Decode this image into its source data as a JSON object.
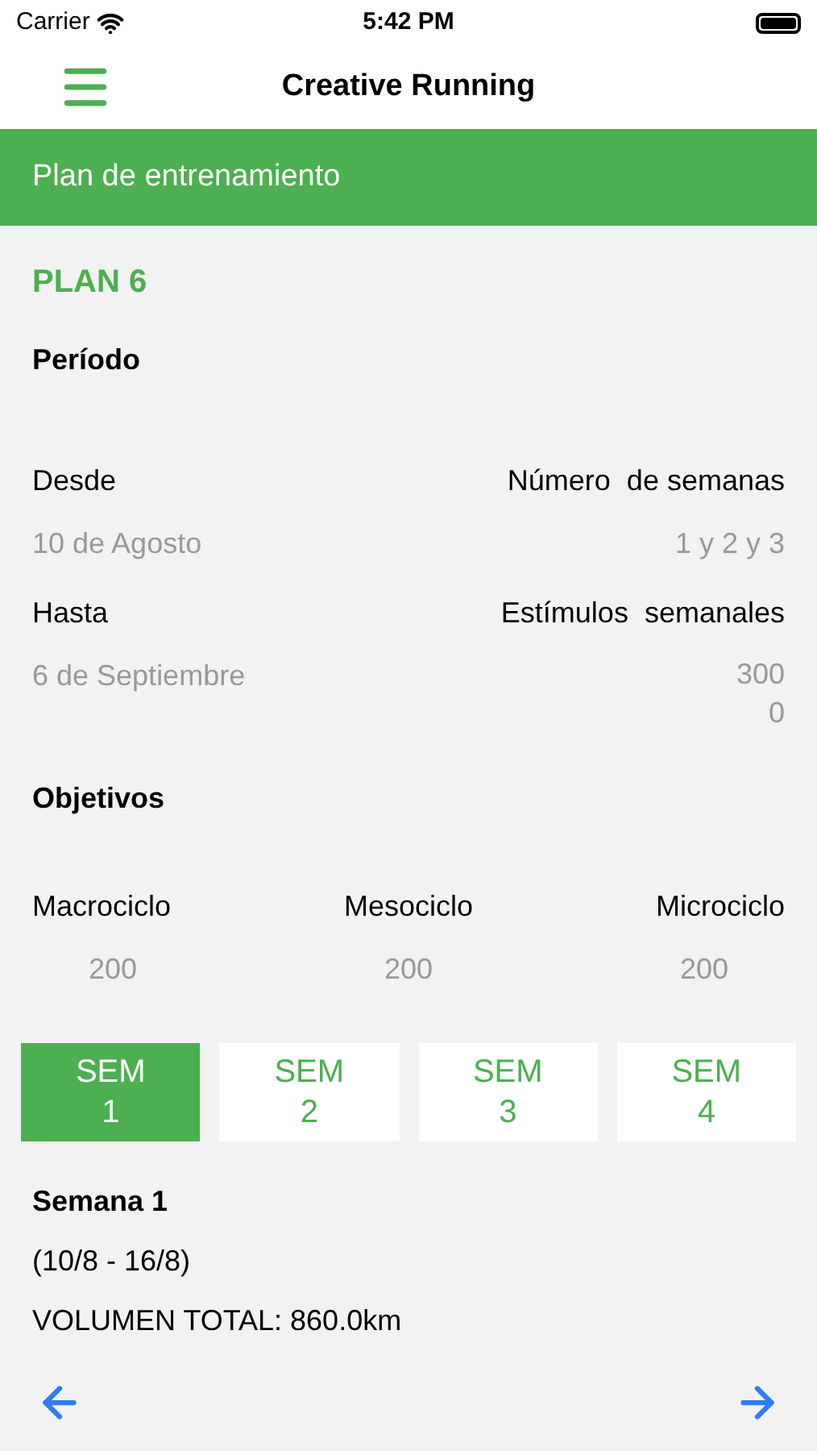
{
  "status_bar": {
    "carrier": "Carrier",
    "time": "5:42 PM"
  },
  "nav": {
    "title": "Creative Running"
  },
  "header": {
    "title": "Plan de entrenamiento"
  },
  "plan": {
    "name": "PLAN 6",
    "period_heading": "Período",
    "fields": [
      {
        "label": "Desde",
        "value": "10 de Agosto"
      },
      {
        "label": "Número  de semanas",
        "value": "1 y 2 y 3"
      },
      {
        "label": "Hasta",
        "value": "6 de Septiembre"
      },
      {
        "label": "Estímulos  semanales",
        "value": "3000"
      }
    ],
    "objectives_heading": "Objetivos",
    "objectives": [
      {
        "label": "Macrociclo",
        "value": "200"
      },
      {
        "label": "Mesociclo",
        "value": "200"
      },
      {
        "label": "Microciclo",
        "value": "200"
      }
    ]
  },
  "weeks": [
    {
      "label": "SEM",
      "number": "1",
      "selected": true
    },
    {
      "label": "SEM",
      "number": "2",
      "selected": false
    },
    {
      "label": "SEM",
      "number": "3",
      "selected": false
    },
    {
      "label": "SEM",
      "number": "4",
      "selected": false
    }
  ],
  "week_detail": {
    "title": "Semana 1",
    "range": "(10/8 - 16/8)",
    "volume": "VOLUMEN TOTAL: 860.0km"
  }
}
